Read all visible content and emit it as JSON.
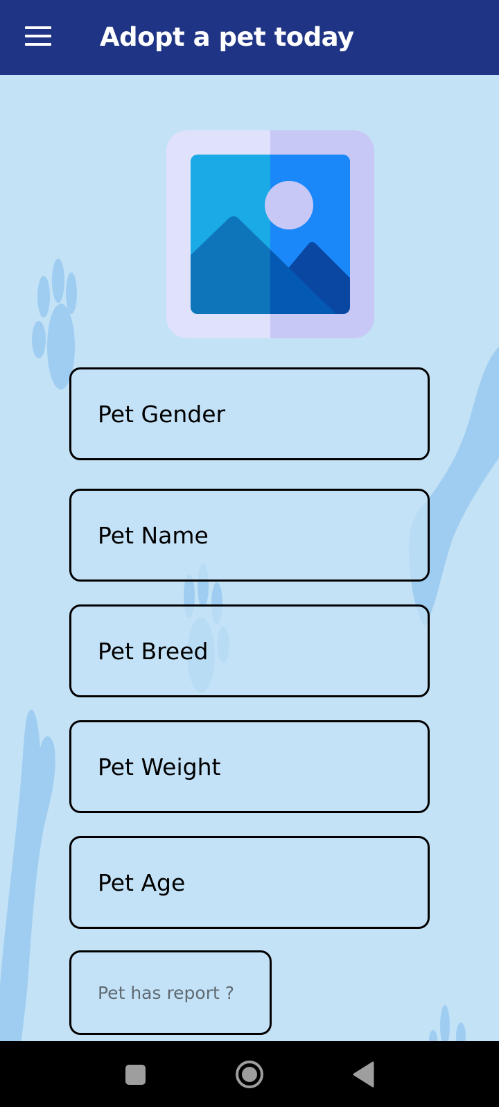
{
  "app_bar": {
    "menu_icon": "hamburger-menu-icon",
    "title": "Adopt a pet today",
    "background_color": "#1f3484"
  },
  "photo_picker": {
    "icon": "image-placeholder-icon"
  },
  "form": {
    "fields": [
      {
        "placeholder": "Pet Gender"
      },
      {
        "placeholder": "Pet Name"
      },
      {
        "placeholder": "Pet Breed"
      },
      {
        "placeholder": "Pet Weight"
      },
      {
        "placeholder": "Pet Age"
      }
    ],
    "report_button": "Pet has report ?"
  },
  "background": {
    "color": "#c4e2f6",
    "decoration": "paw-print-icon"
  },
  "system_nav": {
    "recents_icon": "square-recents-icon",
    "home_icon": "circle-home-icon",
    "back_icon": "triangle-back-icon"
  }
}
